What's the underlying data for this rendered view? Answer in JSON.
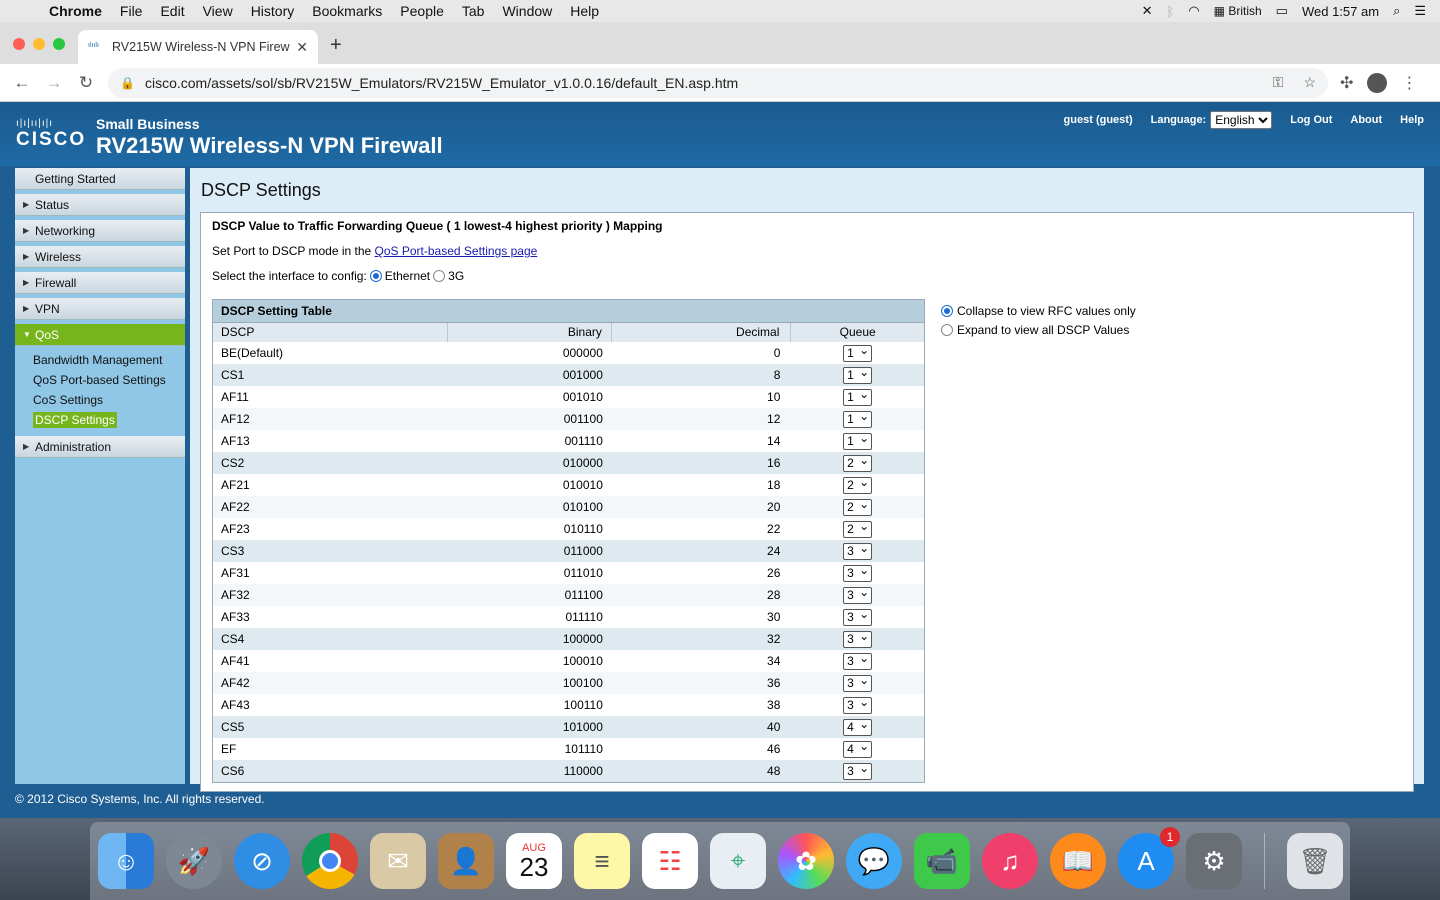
{
  "menubar": {
    "app": "Chrome",
    "items": [
      "File",
      "Edit",
      "View",
      "History",
      "Bookmarks",
      "People",
      "Tab",
      "Window",
      "Help"
    ],
    "input_source": "British",
    "clock": "Wed 1:57 am"
  },
  "browser": {
    "tab_title": "RV215W Wireless-N VPN Firew",
    "url": "cisco.com/assets/sol/sb/RV215W_Emulators/RV215W_Emulator_v1.0.0.16/default_EN.asp.htm"
  },
  "header": {
    "logo_word": "CISCO",
    "small_business": "Small Business",
    "product": "RV215W Wireless-N VPN Firewall",
    "user": "guest (guest)",
    "language_label": "Language:",
    "language_value": "English",
    "logout": "Log Out",
    "about": "About",
    "help": "Help"
  },
  "sidebar": {
    "items": [
      "Getting Started",
      "Status",
      "Networking",
      "Wireless",
      "Firewall",
      "VPN",
      "QoS",
      "Administration"
    ],
    "qos_sub": [
      "Bandwidth Management",
      "QoS Port-based Settings",
      "CoS Settings",
      "DSCP Settings"
    ]
  },
  "content": {
    "page_title": "DSCP Settings",
    "mapping_title": "DSCP Value to Traffic Forwarding Queue ( 1 lowest-4 highest priority ) Mapping",
    "port_text": "Set Port to DSCP mode in the ",
    "port_link": "QoS Port-based Settings page",
    "interface_label": "Select the interface to config:",
    "interface_opt1": "Ethernet",
    "interface_opt2": "3G",
    "table_caption": "DSCP Setting Table",
    "col_dscp": "DSCP",
    "col_binary": "Binary",
    "col_decimal": "Decimal",
    "col_queue": "Queue",
    "collapse_label": "Collapse to view RFC values only",
    "expand_label": "Expand to view all DSCP Values",
    "rows": [
      {
        "dscp": "BE(Default)",
        "binary": "000000",
        "decimal": "0",
        "queue": "1"
      },
      {
        "dscp": "CS1",
        "binary": "001000",
        "decimal": "8",
        "queue": "1"
      },
      {
        "dscp": "AF11",
        "binary": "001010",
        "decimal": "10",
        "queue": "1"
      },
      {
        "dscp": "AF12",
        "binary": "001100",
        "decimal": "12",
        "queue": "1"
      },
      {
        "dscp": "AF13",
        "binary": "001110",
        "decimal": "14",
        "queue": "1"
      },
      {
        "dscp": "CS2",
        "binary": "010000",
        "decimal": "16",
        "queue": "2"
      },
      {
        "dscp": "AF21",
        "binary": "010010",
        "decimal": "18",
        "queue": "2"
      },
      {
        "dscp": "AF22",
        "binary": "010100",
        "decimal": "20",
        "queue": "2"
      },
      {
        "dscp": "AF23",
        "binary": "010110",
        "decimal": "22",
        "queue": "2"
      },
      {
        "dscp": "CS3",
        "binary": "011000",
        "decimal": "24",
        "queue": "3"
      },
      {
        "dscp": "AF31",
        "binary": "011010",
        "decimal": "26",
        "queue": "3"
      },
      {
        "dscp": "AF32",
        "binary": "011100",
        "decimal": "28",
        "queue": "3"
      },
      {
        "dscp": "AF33",
        "binary": "011110",
        "decimal": "30",
        "queue": "3"
      },
      {
        "dscp": "CS4",
        "binary": "100000",
        "decimal": "32",
        "queue": "3"
      },
      {
        "dscp": "AF41",
        "binary": "100010",
        "decimal": "34",
        "queue": "3"
      },
      {
        "dscp": "AF42",
        "binary": "100100",
        "decimal": "36",
        "queue": "3"
      },
      {
        "dscp": "AF43",
        "binary": "100110",
        "decimal": "38",
        "queue": "3"
      },
      {
        "dscp": "CS5",
        "binary": "101000",
        "decimal": "40",
        "queue": "4"
      },
      {
        "dscp": "EF",
        "binary": "101110",
        "decimal": "46",
        "queue": "4"
      },
      {
        "dscp": "CS6",
        "binary": "110000",
        "decimal": "48",
        "queue": "3"
      }
    ]
  },
  "footer": {
    "copyright": "© 2012 Cisco Systems, Inc. All rights reserved."
  },
  "dock": {
    "calendar_month": "AUG",
    "calendar_day": "23",
    "app_store_badge": "1"
  },
  "colors": {
    "cisco_blue": "#1f5e93",
    "active_green": "#77b51c",
    "sidebar_bg": "#90c6e6"
  }
}
